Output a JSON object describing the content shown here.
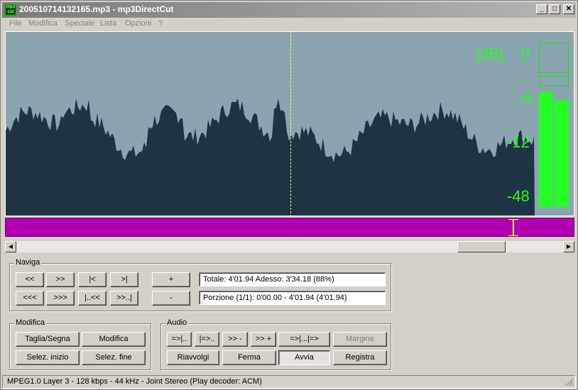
{
  "window": {
    "title": "200510714132165.mp3 - mp3DirectCut",
    "icon_text": "mp3 cut",
    "minimize": "_",
    "maximize": "□",
    "close": "✕"
  },
  "menu": [
    "File",
    "Modifica",
    "Speciale",
    "Lista",
    "Opzioni",
    "?"
  ],
  "meter": {
    "db_unit": "[dB]",
    "db_0": "0",
    "db_6": "-6",
    "db_12": "-12",
    "db_48": "-48",
    "left_level": 0.64,
    "right_level": 0.6,
    "color": "#22ff22"
  },
  "waveform": {
    "background": "#8aa5b0",
    "fill": "#1e3344",
    "cursor_position": 0.5
  },
  "selection": {
    "color": "#b000b0",
    "marker_position": 0.885
  },
  "scroll": {
    "left_arrow": "◀",
    "right_arrow": "▶"
  },
  "naviga": {
    "label": "Naviga",
    "row1": [
      "<<",
      ">>",
      "|<",
      ">|"
    ],
    "row2": [
      "<<<",
      ">>>",
      "|..<<",
      ">>..|"
    ],
    "plus": "+",
    "minus": "-",
    "totale": "Totale: 4'01.94   Adesso: 3'34.18   (88%)",
    "porzione": "Porzione (1/1): 0'00.00 - 4'01.94 (4'01.94)"
  },
  "modifica": {
    "label": "Modifica",
    "taglia": "Taglia/Segna",
    "modifica_btn": "Modifica",
    "selez_inizio": "Selez. inizio",
    "selez_fine": "Selez. fine"
  },
  "audio": {
    "label": "Audio",
    "btn1": "=>|..",
    "btn2": "|=>..",
    "btn3": ">> -",
    "btn4": ">> +",
    "btn5": "=>|...|=>",
    "margine": "Margine",
    "riavvolgi": "Riavvolgi",
    "ferma": "Ferma",
    "avvia": "Avvia",
    "registra": "Registra"
  },
  "status": {
    "text": "MPEG1.0 Layer 3 - 128 kbps - 44 kHz - Joint Stereo   (Play decoder: ACM)"
  }
}
